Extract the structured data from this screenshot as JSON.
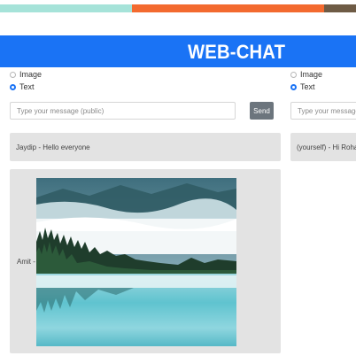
{
  "app": {
    "title": "WEB-CHAT"
  },
  "colors": {
    "accent": "#1a73f5",
    "top_bar": [
      "#a6e3d9",
      "#f36a2f",
      "#6e5b45"
    ]
  },
  "left_panel": {
    "radio_options": [
      {
        "label": "Image",
        "checked": false
      },
      {
        "label": "Text",
        "checked": true
      }
    ],
    "message_input": {
      "placeholder": "Type your message (public)",
      "value": ""
    },
    "send_label": "Send",
    "messages": [
      {
        "type": "text",
        "text": "Jaydip - Hello everyone"
      },
      {
        "type": "image",
        "sender_label": "Amit -",
        "image_icon": "landscape-photo"
      }
    ]
  },
  "right_panel": {
    "radio_options": [
      {
        "label": "Image",
        "checked": false
      },
      {
        "label": "Text",
        "checked": true
      }
    ],
    "message_input": {
      "placeholder": "Type your message (p",
      "value": ""
    },
    "messages": [
      {
        "type": "text",
        "text": "(yourself) - Hi Rohan"
      }
    ]
  }
}
